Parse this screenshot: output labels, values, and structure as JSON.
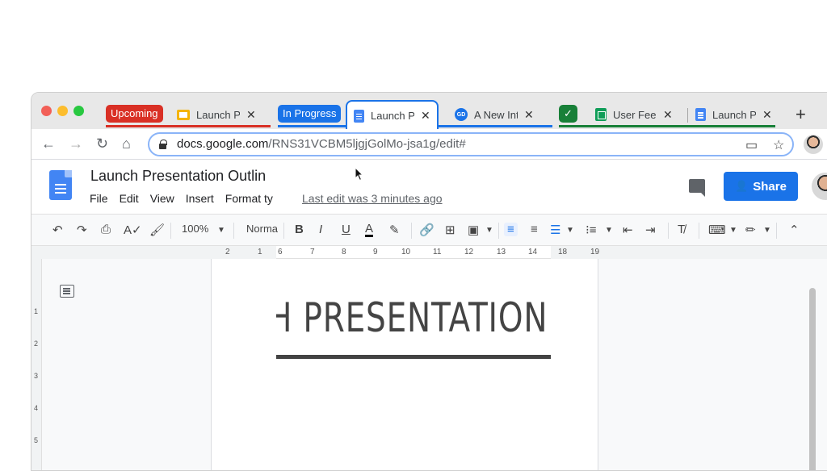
{
  "browser": {
    "tab_groups": [
      {
        "label": "Upcoming",
        "color": "#d93025"
      },
      {
        "label": "In Progress",
        "color": "#1a73e8"
      },
      {
        "label": "✓",
        "color": "#188038"
      }
    ],
    "tabs": [
      {
        "title": "Launch Pl",
        "icon": "slides-icon"
      },
      {
        "title": "Launch P",
        "icon": "docs-icon",
        "active": true
      },
      {
        "title": "A New Int",
        "icon": "gd-icon"
      },
      {
        "title": "User Feed",
        "icon": "sheets-icon"
      },
      {
        "title": "Launch P",
        "icon": "docs-icon"
      }
    ],
    "new_tab": "+",
    "url_domain": "docs.google.com",
    "url_path": "/RNS31VCBM5ljgjGolMo-jsa1g/edit#"
  },
  "docs": {
    "title": "Launch Presentation Outlin",
    "menus": [
      "File",
      "Edit",
      "View",
      "Insert",
      "Format ty"
    ],
    "last_edit": "Last edit was 3 minutes ago",
    "share_label": "Share",
    "toolbar": {
      "zoom": "100%",
      "style": "Norma",
      "bold": "B",
      "italic": "I",
      "underline": "U",
      "text_color": "A"
    },
    "ruler_marks": [
      "2",
      "1",
      "6",
      "7",
      "8",
      "9",
      "10",
      "11",
      "12",
      "13",
      "14",
      "18",
      "19"
    ],
    "vruler_marks": [
      "1",
      "2",
      "3",
      "4",
      "5"
    ],
    "heading_text": "LAUNCH PRESENTATION OUTLINE",
    "heading_visible": "ESENTATION OUTLIN"
  },
  "colors": {
    "accent": "#1a73e8",
    "upcoming": "#d93025",
    "in_progress": "#1a73e8",
    "done": "#188038"
  }
}
